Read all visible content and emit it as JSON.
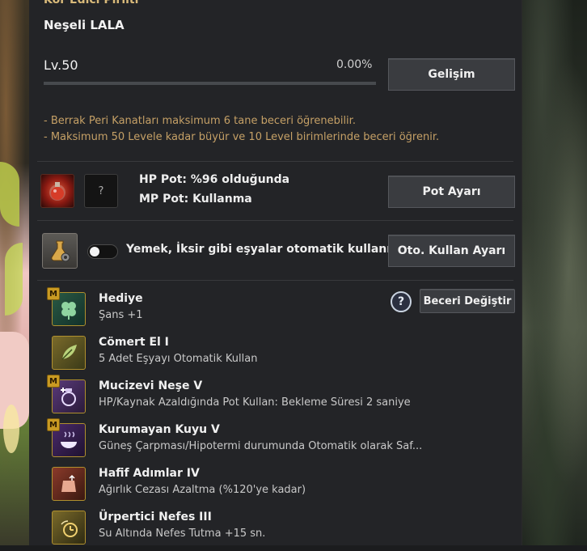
{
  "header": {
    "title_partial": "Kör Edici Pırıltı",
    "pet_name": "Neşeli LALA",
    "level": "Lv.50",
    "progress_text": "0.00%",
    "progress_fraction": 0.0,
    "grow_button": "Gelişim"
  },
  "notes": [
    "- Berrak Peri Kanatları maksimum 6 tane beceri öğrenebilir.",
    "- Maksimum 50 Levele kadar büyür ve 10 Level birimlerinde beceri öğrenir."
  ],
  "potion": {
    "unknown_slot": "?",
    "hp_text": "HP Pot: %96 olduğunda",
    "mp_text": "MP Pot: Kullanma",
    "button": "Pot Ayarı"
  },
  "auto_use": {
    "text": "Yemek, İksir gibi eşyalar otomatik kullanılır.",
    "button": "Oto. Kullan Ayarı",
    "toggle_on": false
  },
  "skills_header": {
    "help_symbol": "?",
    "change_button": "Beceri Değiştir"
  },
  "skills": [
    {
      "badge": "M",
      "name": "Hediye",
      "desc": "Şans +1",
      "icon": "clover-icon"
    },
    {
      "badge": "",
      "name": "Cömert El I",
      "desc": "5 Adet Eşyayı Otomatik Kullan",
      "icon": "leaf-hand-icon"
    },
    {
      "badge": "M",
      "name": "Mucizevi Neşe V",
      "desc": "HP/Kaynak Azaldığında Pot Kullan: Bekleme Süresi 2 saniye",
      "icon": "potion-plus-icon"
    },
    {
      "badge": "M",
      "name": "Kurumayan Kuyu V",
      "desc": "Güneş Çarpması/Hipotermi durumunda Otomatik olarak Saf...",
      "icon": "steaming-bowl-icon"
    },
    {
      "badge": "",
      "name": "Hafif Adımlar IV",
      "desc": "Ağırlık Cezası Azaltma (%120'ye kadar)",
      "icon": "weight-bag-icon"
    },
    {
      "badge": "",
      "name": "Ürpertici Nefes III",
      "desc": "Su Altında Nefes Tutma +15 sn.",
      "icon": "breath-timer-icon"
    }
  ],
  "colors": {
    "panel_bg": "#232427",
    "note_color": "#c5a066",
    "skill_border": "#b0902e"
  }
}
